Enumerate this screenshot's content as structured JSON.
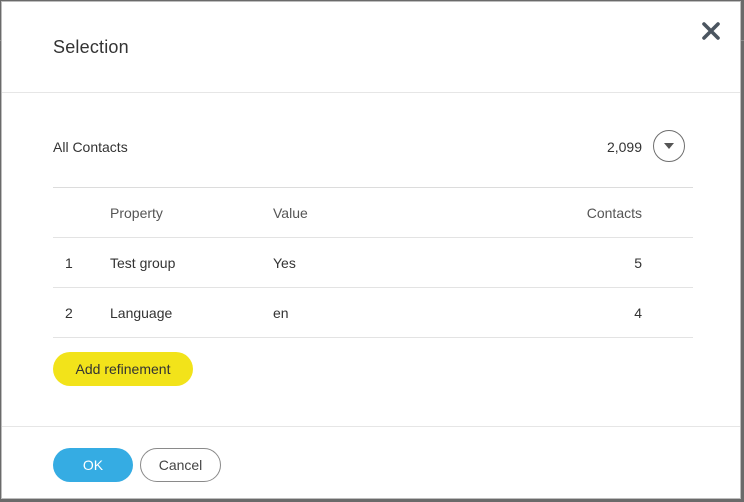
{
  "dialog": {
    "title": "Selection",
    "close_icon": "close-x-icon"
  },
  "selection": {
    "name": "All Contacts",
    "count": "2,099",
    "dropdown_icon": "caret-down-icon"
  },
  "table": {
    "headers": {
      "index": "",
      "property": "Property",
      "value": "Value",
      "contacts": "Contacts"
    },
    "rows": [
      {
        "index": "1",
        "property": "Test group",
        "value": "Yes",
        "contacts": "5"
      },
      {
        "index": "2",
        "property": "Language",
        "value": "en",
        "contacts": "4"
      }
    ]
  },
  "actions": {
    "add_refinement_label": "Add refinement",
    "ok_label": "OK",
    "cancel_label": "Cancel"
  },
  "colors": {
    "add_refinement_bg": "#f2e31a",
    "ok_bg": "#35ace3",
    "text": "#333333",
    "backdrop": "#6a6a6a"
  }
}
